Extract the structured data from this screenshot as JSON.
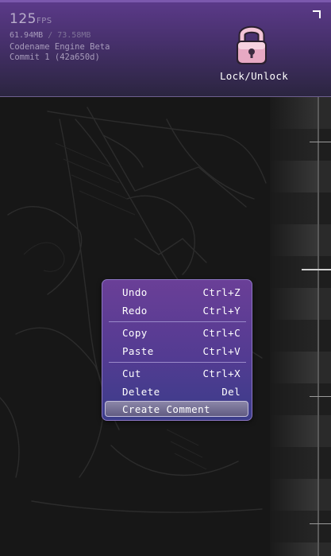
{
  "overlay": {
    "fps_value": "125",
    "fps_unit": "FPS",
    "memory_used": "61.94MB",
    "memory_separator": "/",
    "memory_peak": "73.58MB",
    "engine_name": "Codename Engine Beta",
    "commit": "Commit 1 (42a650d)"
  },
  "toolbar": {
    "lock_label": "Lock/Unlock",
    "lock_icon": "padlock-icon"
  },
  "context_menu": {
    "items": [
      {
        "label": "Undo",
        "shortcut": "Ctrl+Z"
      },
      {
        "label": "Redo",
        "shortcut": "Ctrl+Y"
      },
      {
        "label": "Copy",
        "shortcut": "Ctrl+C"
      },
      {
        "label": "Paste",
        "shortcut": "Ctrl+V"
      },
      {
        "label": "Cut",
        "shortcut": "Ctrl+X"
      },
      {
        "label": "Delete",
        "shortcut": "Del"
      },
      {
        "label": "Create Comment",
        "shortcut": "",
        "highlighted": true
      }
    ]
  },
  "colors": {
    "header_top": "#5c3a8a",
    "header_bottom": "#2b2540",
    "menu_top": "#6a3f97",
    "menu_bottom": "#3b3d8a",
    "menu_border": "#8d77c4",
    "canvas_bg": "#171717",
    "grid_dark": "#262626",
    "grid_light": "#383838"
  }
}
